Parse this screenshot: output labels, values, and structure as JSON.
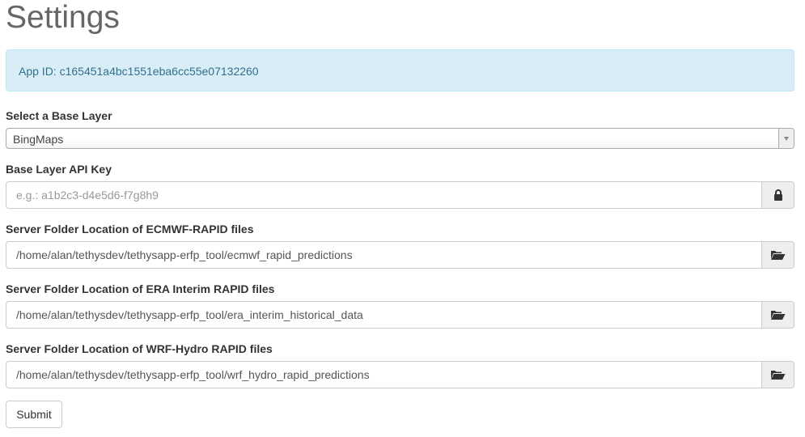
{
  "page": {
    "title": "Settings"
  },
  "alert": {
    "text": "App ID: c165451a4bc1551eba6cc55e07132260"
  },
  "base_layer": {
    "label": "Select a Base Layer",
    "selected": "BingMaps"
  },
  "api_key": {
    "label": "Base Layer API Key",
    "value": "",
    "placeholder": "e.g.: a1b2c3-d4e5d6-f7g8h9",
    "icon": "lock-icon"
  },
  "ecmwf": {
    "label": "Server Folder Location of ECMWF-RAPID files",
    "value": "/home/alan/tethysdev/tethysapp-erfp_tool/ecmwf_rapid_predictions",
    "icon": "folder-open-icon"
  },
  "era_interim": {
    "label": "Server Folder Location of ERA Interim RAPID files",
    "value": "/home/alan/tethysdev/tethysapp-erfp_tool/era_interim_historical_data",
    "icon": "folder-open-icon"
  },
  "wrf_hydro": {
    "label": "Server Folder Location of WRF-Hydro RAPID files",
    "value": "/home/alan/tethysdev/tethysapp-erfp_tool/wrf_hydro_rapid_predictions",
    "icon": "folder-open-icon"
  },
  "submit": {
    "label": "Submit"
  },
  "colors": {
    "alert_bg": "#d9edf7",
    "alert_text": "#31708f",
    "title_text": "#666666"
  }
}
